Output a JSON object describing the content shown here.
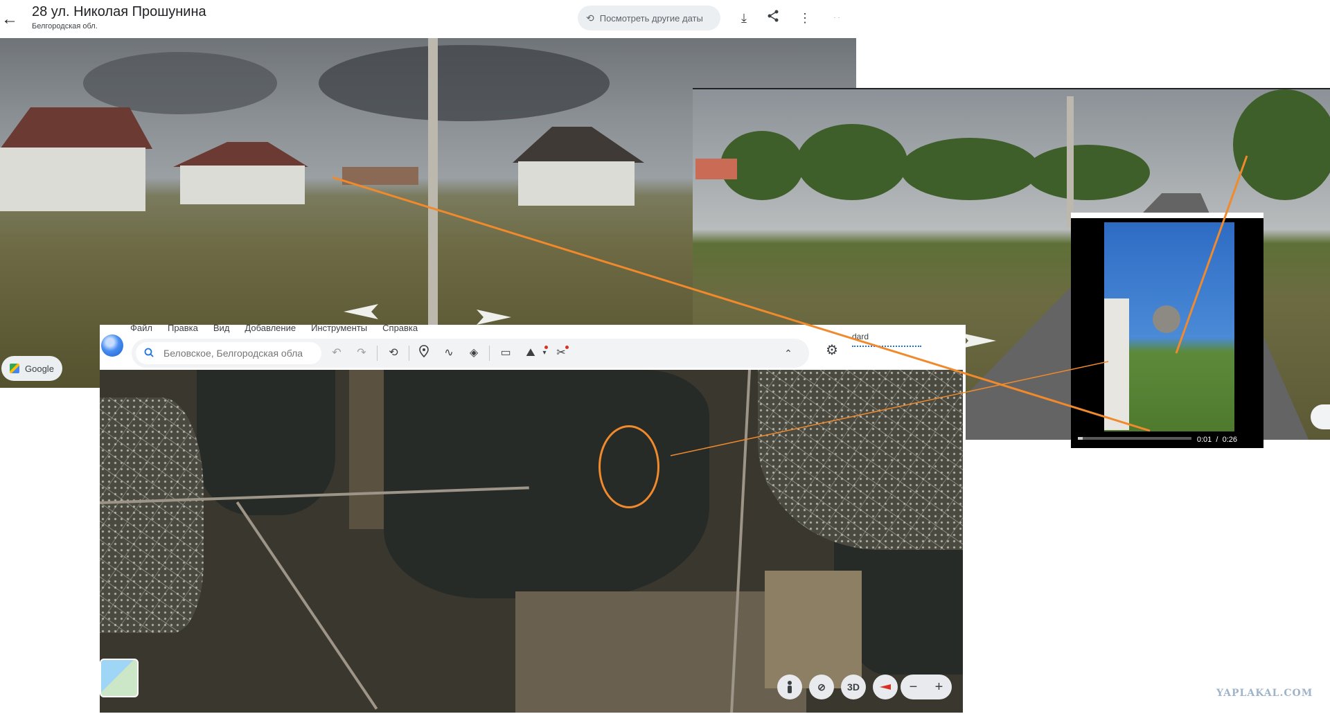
{
  "street_view": {
    "title": "28 ул. Николая Прошунина",
    "subtitle": "Белгородская обл.",
    "other_dates_label": "Посмотреть другие даты",
    "google_badge": "Google"
  },
  "video": {
    "time_current": "0:01",
    "time_separator": "/",
    "time_total": "0:26",
    "progress": 0.04
  },
  "earth": {
    "menu": [
      "Файл",
      "Правка",
      "Вид",
      "Добавление",
      "Инструменты",
      "Справка"
    ],
    "search_placeholder": "Беловское, Белгородская обла",
    "account_label": "dard",
    "view_3d_label": "3D",
    "zoom_out_label": "−",
    "zoom_in_label": "+"
  },
  "watermark": "YAPLAKAL.COM",
  "colors": {
    "annotation": "#f08a2c",
    "accent": "#1a73e8"
  },
  "icons": [
    "back-arrow-icon",
    "history-icon",
    "fullscreen-icon",
    "share-icon",
    "more-vert-icon",
    "search-icon",
    "undo-icon",
    "redo-icon",
    "history-icon",
    "pin-icon",
    "path-icon",
    "layers-icon",
    "ruler-icon",
    "map-style-icon",
    "tools-icon",
    "chevron-up-icon",
    "gear-icon",
    "pegman-icon",
    "compass-icon"
  ]
}
